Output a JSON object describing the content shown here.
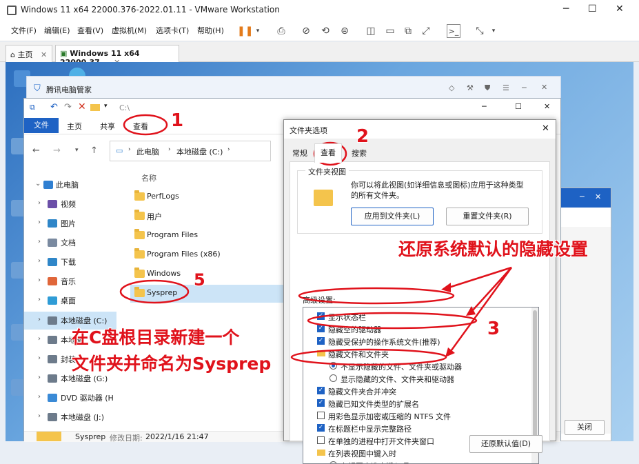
{
  "vmware": {
    "title": "Windows 11 x64 22000.376-2022.01.11 - VMware Workstation",
    "menu": [
      "文件(F)",
      "编辑(E)",
      "查看(V)",
      "虚拟机(M)",
      "选项卡(T)",
      "帮助(H)"
    ],
    "tabs": [
      {
        "label": "主页"
      },
      {
        "label": "Windows 11 x64 22000.37..."
      }
    ]
  },
  "tencent": {
    "title": "腾讯电脑管家"
  },
  "explorer": {
    "qat_path": "C:\\",
    "ribbon": {
      "file": "文件",
      "home": "主页",
      "share": "共享",
      "view": "查看"
    },
    "address": [
      "此电脑",
      "本地磁盘 (C:)"
    ],
    "column_name": "名称",
    "nav": [
      {
        "label": "此电脑",
        "color": "#2f7fd1"
      },
      {
        "label": "视频",
        "color": "#6b4fa8"
      },
      {
        "label": "图片",
        "color": "#2f86c8"
      },
      {
        "label": "文档",
        "color": "#7a8aa0"
      },
      {
        "label": "下载",
        "color": "#2f86c8"
      },
      {
        "label": "音乐",
        "color": "#e0663a"
      },
      {
        "label": "桌面",
        "color": "#2f9cd6"
      },
      {
        "label": "本地磁盘 (C:)",
        "color": "#6d7b8b"
      },
      {
        "label": "本地磁",
        "color": "#6d7b8b"
      },
      {
        "label": "封装",
        "color": "#6d7b8b"
      },
      {
        "label": "本地磁盘 (G:)",
        "color": "#6d7b8b"
      },
      {
        "label": "DVD 驱动器 (H",
        "color": "#3a8ad6"
      },
      {
        "label": "本地磁盘 (J:)",
        "color": "#6d7b8b"
      }
    ],
    "files": [
      "PerfLogs",
      "用户",
      "Program Files",
      "Program Files (x86)",
      "Windows",
      "Sysprep"
    ],
    "status": {
      "name": "Sysprep",
      "date_label": "修改日期:",
      "date": "2022/1/16 21:47"
    }
  },
  "dialog": {
    "title": "文件夹选项",
    "tabs": [
      "常规",
      "查看",
      "搜索"
    ],
    "folder_view_title": "文件夹视图",
    "folder_view_desc": "你可以将此视图(如详细信息或图标)应用于这种类型的所有文件夹。",
    "apply_btn": "应用到文件夹(L)",
    "reset_btn": "重置文件夹(R)",
    "advanced_label": "高级设置:",
    "advanced": [
      {
        "kind": "check",
        "on": true,
        "label": "显示状态栏"
      },
      {
        "kind": "check",
        "on": true,
        "label": "隐藏空的驱动器"
      },
      {
        "kind": "check",
        "on": true,
        "label": "隐藏受保护的操作系统文件(推荐)"
      },
      {
        "kind": "folder",
        "label": "隐藏文件和文件夹"
      },
      {
        "kind": "radio",
        "on": true,
        "label": "不显示隐藏的文件、文件夹或驱动器"
      },
      {
        "kind": "radio",
        "on": false,
        "label": "显示隐藏的文件、文件夹和驱动器"
      },
      {
        "kind": "check",
        "on": true,
        "label": "隐藏文件夹合并冲突"
      },
      {
        "kind": "check",
        "on": true,
        "label": "隐藏已知文件类型的扩展名"
      },
      {
        "kind": "check",
        "on": false,
        "label": "用彩色显示加密或压缩的 NTFS 文件"
      },
      {
        "kind": "check",
        "on": true,
        "label": "在标题栏中显示完整路径"
      },
      {
        "kind": "check",
        "on": false,
        "label": "在单独的进程中打开文件夹窗口"
      },
      {
        "kind": "folder",
        "label": "在列表视图中键入时"
      },
      {
        "kind": "radio",
        "on": true,
        "label": "在视图中选中键入项"
      }
    ],
    "restore_btn": "还原默认值(D)"
  },
  "bg_window": {
    "close_btn": "关闭"
  },
  "annotations": {
    "n1": "1",
    "n2": "2",
    "n3": "3",
    "n5": "5",
    "restore_text": "还原系统默认的隐藏设置",
    "create_text_1": "在C盘根目录新建一个",
    "create_text_2": "文件夹并命名为Sysprep",
    "color": "#e0121b"
  }
}
